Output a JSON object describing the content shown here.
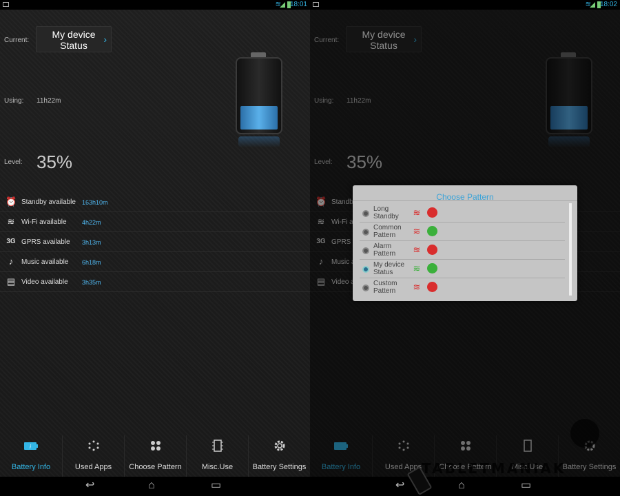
{
  "screens": [
    {
      "status_time": "18:01",
      "current_label": "Current:",
      "current_value": "My device\nStatus",
      "using_label": "Using:",
      "using_value": "11h22m",
      "level_label": "Level:",
      "level_value": "35%",
      "battery_level": 0.35,
      "availability": [
        {
          "label": "Standby available",
          "value": "163h10m",
          "icon": "alarm-clock-icon"
        },
        {
          "label": "Wi-Fi available",
          "value": "4h22m",
          "icon": "wifi-icon"
        },
        {
          "label": "GPRS available",
          "value": "3h13m",
          "icon": "3g-icon"
        },
        {
          "label": "Music available",
          "value": "6h18m",
          "icon": "music-note-icon"
        },
        {
          "label": "Video available",
          "value": "3h35m",
          "icon": "film-icon"
        }
      ]
    },
    {
      "status_time": "18:02",
      "current_label": "Current:",
      "current_value": "My device\nStatus",
      "using_label": "Using:",
      "using_value": "11h22m",
      "level_label": "Level:",
      "level_value": "35%",
      "availability": [
        {
          "label": "Standby",
          "icon": "alarm-clock-icon"
        },
        {
          "label": "Wi-Fi av",
          "icon": "wifi-icon"
        },
        {
          "label": "GPRS av",
          "icon": "3g-icon"
        },
        {
          "label": "Music a",
          "icon": "music-note-icon"
        },
        {
          "label": "Video a",
          "icon": "film-icon"
        }
      ]
    }
  ],
  "tabs": [
    {
      "label": "Battery Info",
      "icon": "battery-icon",
      "active": true
    },
    {
      "label": "Used Apps",
      "icon": "dots-circle-icon"
    },
    {
      "label": "Choose Pattern",
      "icon": "four-dots-icon"
    },
    {
      "label": "Misc.Use",
      "icon": "chip-icon"
    },
    {
      "label": "Battery Settings",
      "icon": "gear-icon"
    }
  ],
  "dialog": {
    "title": "Choose Pattern",
    "options": [
      {
        "name": "Long\nStandby",
        "wifi": "off",
        "data": "off",
        "selected": false
      },
      {
        "name": "Common\nPattern",
        "wifi": "off",
        "data": "on",
        "selected": false
      },
      {
        "name": "Alarm\nPattern",
        "wifi": "off",
        "data": "off",
        "selected": false
      },
      {
        "name": "My device\nStatus",
        "wifi": "on",
        "data": "on",
        "selected": true
      },
      {
        "name": "Custom\nPattern",
        "wifi": "off",
        "data": "off",
        "selected": false
      }
    ]
  },
  "watermark": "TABLETMANIAK",
  "colors": {
    "accent": "#33b5e5",
    "value_blue": "#4fb6ef",
    "off_red": "#d92d2d",
    "on_green": "#3bb03b"
  }
}
